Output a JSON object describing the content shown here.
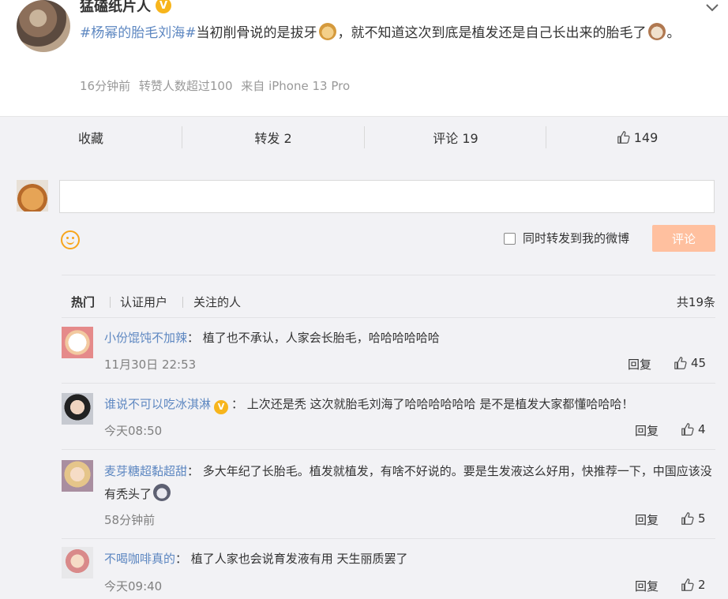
{
  "post": {
    "author": "猛磕纸片人",
    "verified_badge": "V",
    "hashtag": "#杨幂的胎毛刘海#",
    "text_part1": "当初削骨说的是拔牙",
    "text_part2": "，就不知道这次到底是植发还是自己长出来的胎毛了",
    "text_part3": "。",
    "meta_time": "16分钟前",
    "meta_reposts": "转赞人数超过100",
    "meta_source": "来自 iPhone 13 Pro"
  },
  "actions": {
    "favorite": "收藏",
    "repost": "转发 2",
    "comment": "评论 19",
    "like_count": "149"
  },
  "composer": {
    "repost_option": "同时转发到我的微博",
    "submit": "评论"
  },
  "filters": {
    "hot": "热门",
    "verified": "认证用户",
    "following": "关注的人",
    "total": "共19条"
  },
  "comments": [
    {
      "name": "小份馄饨不加辣",
      "text": "：  植了也不承认，人家会长胎毛，哈哈哈哈哈哈",
      "time": "11月30日 22:53",
      "reply": "回复",
      "likes": "45"
    },
    {
      "name": "谁说不可以吃冰淇淋",
      "text": "：  上次还是秃 这次就胎毛刘海了哈哈哈哈哈哈 是不是植发大家都懂哈哈哈！",
      "time": "今天08:50",
      "reply": "回复",
      "likes": "4"
    },
    {
      "name": "麦芽糖超黏超甜",
      "text": "：  多大年纪了长胎毛。植发就植发，有啥不好说的。要是生发液这么好用，快推荐一下，中国应该没有秃头了",
      "time": "58分钟前",
      "reply": "回复",
      "likes": "5"
    },
    {
      "name": "不喝咖啡真的",
      "text": "：  植了人家也会说育发液有用 天生丽质罢了",
      "time": "今天09:40",
      "reply": "回复",
      "likes": "2"
    }
  ],
  "icons": {
    "more": "chevron-down-icon",
    "like": "thumbs-up-icon",
    "emoji": "smiley-icon"
  }
}
